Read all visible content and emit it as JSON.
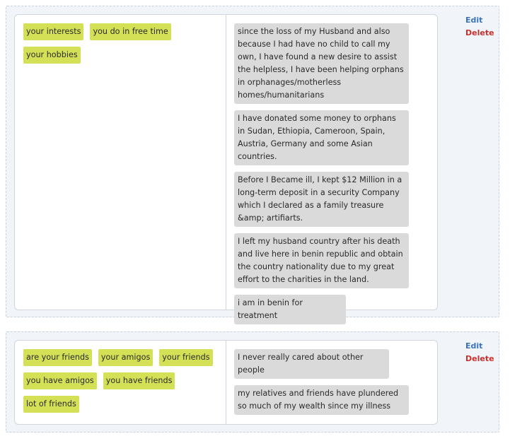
{
  "colors": {
    "pill_bg": "#d4e157",
    "response_bg": "#dadada",
    "card_bg": "#f1f5f9",
    "edit_link": "#3b73b9",
    "delete_link": "#c9302c"
  },
  "entries": [
    {
      "patterns": [
        "your interests",
        "you do in free time",
        "your hobbies"
      ],
      "responses": [
        "since the loss of my Husband and also because I had have no child to call my own, I have found a new desire to assist the helpless, I have been helping orphans in orphanages/motherless homes/humanitarians",
        "I have donated some money to orphans in Sudan, Ethiopia, Cameroon, Spain, Austria, Germany and some Asian countries.",
        "Before I Became ill, I kept $12 Million in a long-term deposit in a security Company which I declared as a family treasure &amp; artifiarts.",
        "I left my husband country after his death and live here in benin republic and obtain the country nationality due to my great effort to the charities in the land.",
        "i am in benin for treatment"
      ],
      "edit_label": "Edit",
      "delete_label": "Delete"
    },
    {
      "patterns": [
        "are your friends",
        "your amigos",
        "your friends",
        "you have amigos",
        "you have friends",
        "lot of friends"
      ],
      "responses": [
        "I never really cared about other people",
        "my relatives and friends have plundered so much of my wealth since my illness"
      ],
      "edit_label": "Edit",
      "delete_label": "Delete"
    }
  ]
}
